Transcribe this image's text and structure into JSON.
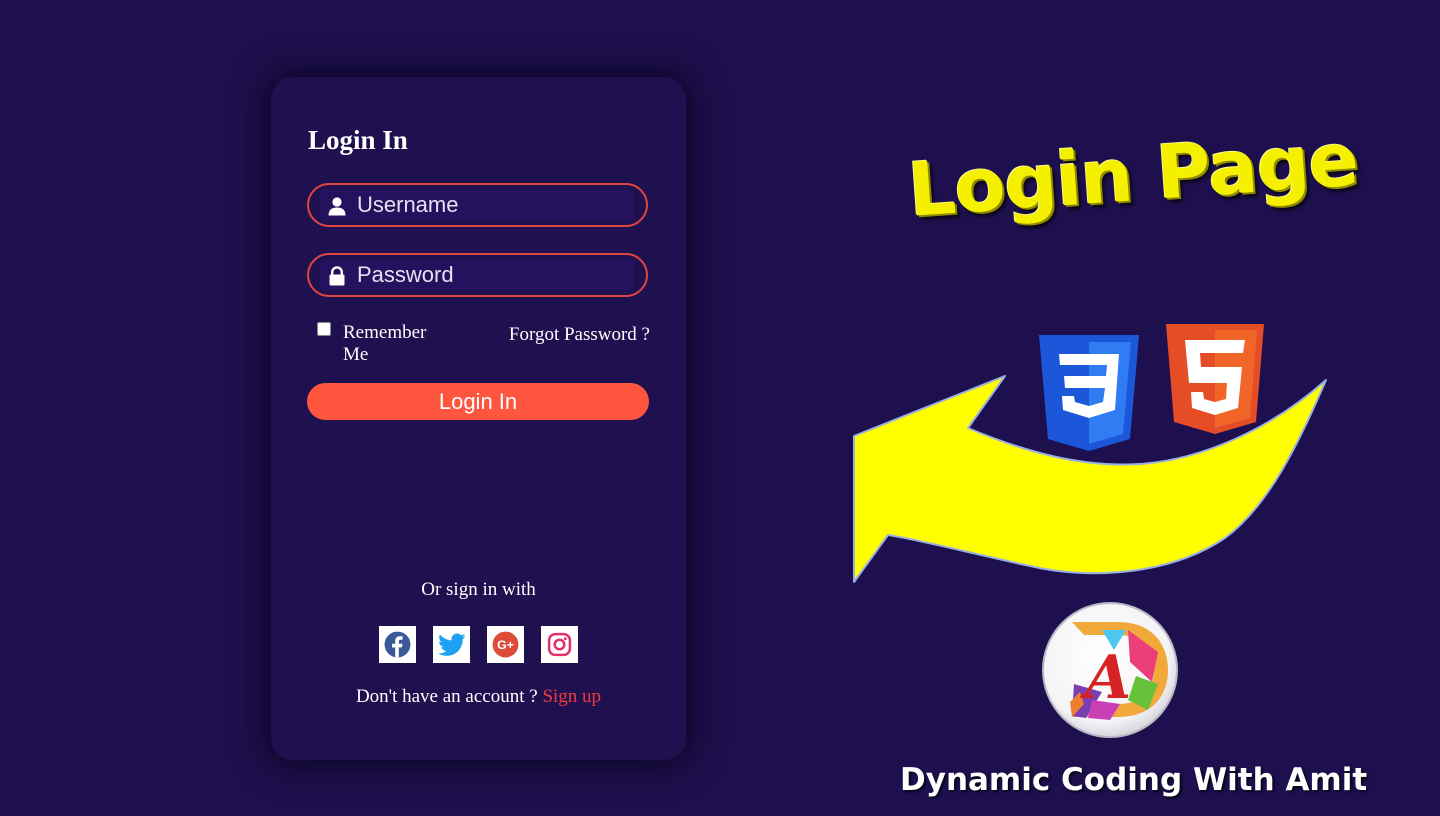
{
  "login_form": {
    "title": "Login In",
    "username_placeholder": "Username",
    "password_placeholder": "Password",
    "remember_label": "Remember Me",
    "remember_checked": false,
    "forgot_label": "Forgot Password ?",
    "login_button_label": "Login In",
    "social_prompt": "Or sign in with",
    "social_icons": [
      "facebook-icon",
      "twitter-icon",
      "google-plus-icon",
      "instagram-icon"
    ],
    "signup_prompt": "Don't have an account ?",
    "signup_link": "Sign up"
  },
  "hero": {
    "title": "Login Page",
    "brand_logo_letter": "A",
    "brand_name": "Dynamic Coding With Amit",
    "icons": [
      "css3-icon",
      "html5-icon",
      "yellow-arrow-icon"
    ]
  },
  "colors": {
    "background": "#1e104e",
    "card": "#1f104f",
    "accent": "#fe553f",
    "input_border": "#e0453f",
    "signup_link": "#f0393e",
    "hero_title": "#f5f000"
  }
}
